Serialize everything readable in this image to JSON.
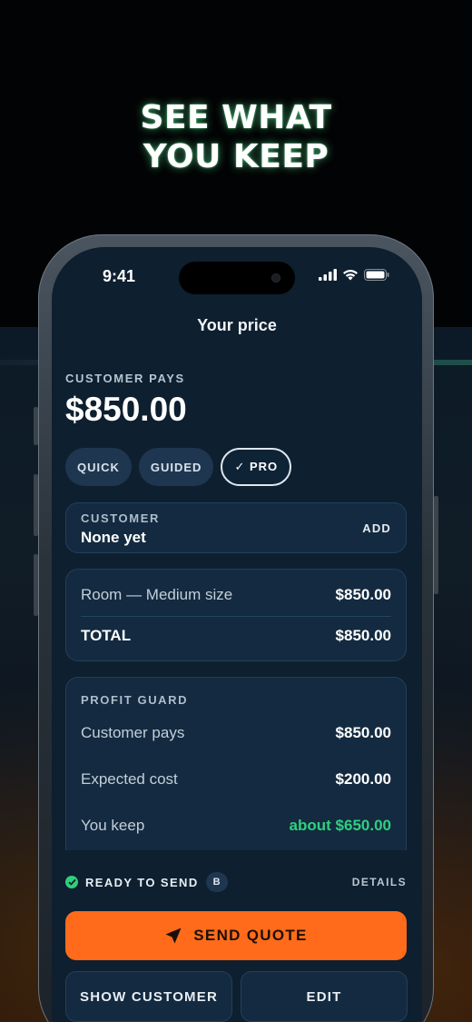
{
  "promo": {
    "headline_line1": "SEE WHAT",
    "headline_line2": "YOU KEEP"
  },
  "status_bar": {
    "time": "9:41",
    "icons": [
      "cellular-signal-icon",
      "wifi-icon",
      "battery-icon"
    ]
  },
  "screen": {
    "title": "Your price"
  },
  "price": {
    "label": "CUSTOMER PAYS",
    "amount": "$850.00"
  },
  "modes": [
    {
      "label": "QUICK",
      "active": false
    },
    {
      "label": "GUIDED",
      "active": false
    },
    {
      "label": "✓ PRO",
      "active": true
    }
  ],
  "customer": {
    "label": "CUSTOMER",
    "value": "None yet",
    "action": "ADD"
  },
  "line_items": {
    "item_label": "Room — Medium size",
    "item_value": "$850.00",
    "total_label": "TOTAL",
    "total_value": "$850.00"
  },
  "profit_guard": {
    "title": "PROFIT GUARD",
    "rows": [
      {
        "label": "Customer pays",
        "value": "$850.00"
      },
      {
        "label": "Expected cost",
        "value": "$200.00"
      },
      {
        "label": "You keep",
        "value": "about $650.00"
      }
    ]
  },
  "status": {
    "ready_text": "READY TO SEND",
    "badge": "B",
    "details": "DETAILS"
  },
  "actions": {
    "send_label": "SEND QUOTE",
    "show_customer_label": "SHOW CUSTOMER",
    "edit_label": "EDIT"
  },
  "colors": {
    "accent_orange": "#ff6b1a",
    "success_green": "#2fd07e",
    "screen_background": "#0e1f2f",
    "card_background": "#132a40"
  }
}
